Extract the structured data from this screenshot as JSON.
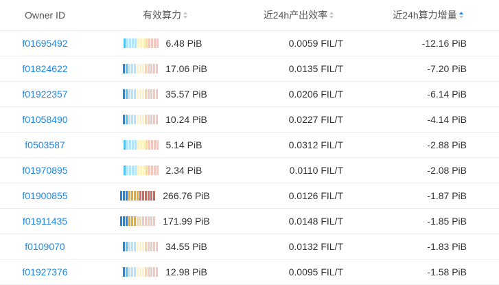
{
  "headers": {
    "owner": "Owner ID",
    "power": "有效算力",
    "efficiency": "近24h产出效率",
    "increase": "近24h算力增量"
  },
  "colors": {
    "link": "#1e88e5",
    "sort_active": "#1e88e5",
    "sort_inactive": "#c0c4cc",
    "bar_palette": [
      "#1e88e5",
      "#4fc3f7",
      "#b3e5fc",
      "#fff3c4",
      "#f5d7a3",
      "#f2c9c0",
      "#d4685a",
      "#e6ac2c"
    ]
  },
  "rows": [
    {
      "owner": "f01695492",
      "power": "6.48 PiB",
      "power_pib": 6.48,
      "efficiency": "0.0059 FIL/T",
      "increase": "-12.16 PiB"
    },
    {
      "owner": "f01824622",
      "power": "17.06 PiB",
      "power_pib": 17.06,
      "efficiency": "0.0135 FIL/T",
      "increase": "-7.20 PiB"
    },
    {
      "owner": "f01922357",
      "power": "35.57 PiB",
      "power_pib": 35.57,
      "efficiency": "0.0206 FIL/T",
      "increase": "-6.14 PiB"
    },
    {
      "owner": "f01058490",
      "power": "10.24 PiB",
      "power_pib": 10.24,
      "efficiency": "0.0227 FIL/T",
      "increase": "-4.14 PiB"
    },
    {
      "owner": "f0503587",
      "power": "5.14 PiB",
      "power_pib": 5.14,
      "efficiency": "0.0312 FIL/T",
      "increase": "-2.88 PiB"
    },
    {
      "owner": "f01970895",
      "power": "2.34 PiB",
      "power_pib": 2.34,
      "efficiency": "0.0110 FIL/T",
      "increase": "-2.08 PiB"
    },
    {
      "owner": "f01900855",
      "power": "266.76 PiB",
      "power_pib": 266.76,
      "efficiency": "0.0126 FIL/T",
      "increase": "-1.87 PiB"
    },
    {
      "owner": "f01911435",
      "power": "171.99 PiB",
      "power_pib": 171.99,
      "efficiency": "0.0148 FIL/T",
      "increase": "-1.85 PiB"
    },
    {
      "owner": "f0109070",
      "power": "34.55 PiB",
      "power_pib": 34.55,
      "efficiency": "0.0132 FIL/T",
      "increase": "-1.83 PiB"
    },
    {
      "owner": "f01927376",
      "power": "12.98 PiB",
      "power_pib": 12.98,
      "efficiency": "0.0095 FIL/T",
      "increase": "-1.58 PiB"
    }
  ]
}
